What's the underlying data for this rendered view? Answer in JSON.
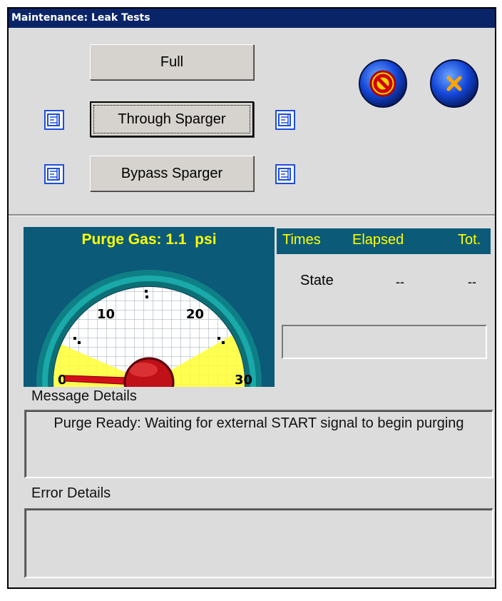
{
  "window": {
    "title": "Maintenance: Leak Tests"
  },
  "buttons": {
    "full": "Full",
    "through_sparger": "Through Sparger",
    "bypass_sparger": "Bypass Sparger"
  },
  "icons": {
    "abort": "no-entry-icon",
    "close": "close-icon",
    "settings": "edit-settings-icon"
  },
  "gauge": {
    "title": "Purge Gas: 1.1  psi",
    "value_psi": 1.1,
    "range": [
      0,
      30
    ],
    "ticks": [
      "0",
      "10",
      "20",
      "30"
    ]
  },
  "times": {
    "headers": [
      "Times",
      "Elapsed",
      "Tot."
    ],
    "state_label": "State",
    "elapsed": "--",
    "total": "--"
  },
  "message": {
    "label": "Message Details",
    "text": "Purge Ready: Waiting for external START signal to begin purging"
  },
  "error": {
    "label": "Error Details",
    "text": ""
  },
  "colors": {
    "title_bar": "#0a2468",
    "panel": "#0b5a78",
    "highlight_text": "#ffff00",
    "window_bg": "#dcdcdc"
  }
}
